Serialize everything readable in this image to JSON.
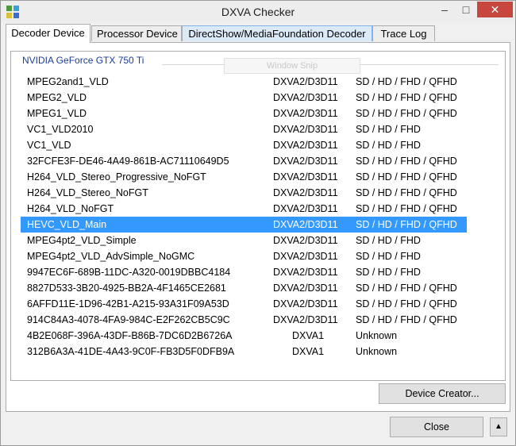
{
  "window": {
    "title": "DXVA Checker",
    "controls": {
      "minimize": "–",
      "maximize": "□",
      "close": "✕"
    },
    "icon": "dxva-app-icon"
  },
  "tabs": [
    {
      "label": "Decoder Device",
      "active": true
    },
    {
      "label": "Processor Device",
      "active": false
    },
    {
      "label": "DirectShow/MediaFoundation Decoder",
      "active": false,
      "hover": true
    },
    {
      "label": "Trace Log",
      "active": false
    }
  ],
  "group": {
    "label": "NVIDIA GeForce GTX 750 Ti",
    "ghost_overlay": "Window Snip"
  },
  "decoders": [
    {
      "name": "MPEG2and1_VLD",
      "api": "DXVA2/D3D11",
      "resolutions": "SD / HD / FHD / QFHD"
    },
    {
      "name": "MPEG2_VLD",
      "api": "DXVA2/D3D11",
      "resolutions": "SD / HD / FHD / QFHD"
    },
    {
      "name": "MPEG1_VLD",
      "api": "DXVA2/D3D11",
      "resolutions": "SD / HD / FHD / QFHD"
    },
    {
      "name": "VC1_VLD2010",
      "api": "DXVA2/D3D11",
      "resolutions": "SD / HD / FHD"
    },
    {
      "name": "VC1_VLD",
      "api": "DXVA2/D3D11",
      "resolutions": "SD / HD / FHD"
    },
    {
      "name": "32FCFE3F-DE46-4A49-861B-AC71110649D5",
      "api": "DXVA2/D3D11",
      "resolutions": "SD / HD / FHD / QFHD"
    },
    {
      "name": "H264_VLD_Stereo_Progressive_NoFGT",
      "api": "DXVA2/D3D11",
      "resolutions": "SD / HD / FHD / QFHD"
    },
    {
      "name": "H264_VLD_Stereo_NoFGT",
      "api": "DXVA2/D3D11",
      "resolutions": "SD / HD / FHD / QFHD"
    },
    {
      "name": "H264_VLD_NoFGT",
      "api": "DXVA2/D3D11",
      "resolutions": "SD / HD / FHD / QFHD"
    },
    {
      "name": "HEVC_VLD_Main",
      "api": "DXVA2/D3D11",
      "resolutions": "SD / HD / FHD / QFHD",
      "selected": true
    },
    {
      "name": "MPEG4pt2_VLD_Simple",
      "api": "DXVA2/D3D11",
      "resolutions": "SD / HD / FHD"
    },
    {
      "name": "MPEG4pt2_VLD_AdvSimple_NoGMC",
      "api": "DXVA2/D3D11",
      "resolutions": "SD / HD / FHD"
    },
    {
      "name": "9947EC6F-689B-11DC-A320-0019DBBC4184",
      "api": "DXVA2/D3D11",
      "resolutions": "SD / HD / FHD"
    },
    {
      "name": "8827D533-3B20-4925-BB2A-4F1465CE2681",
      "api": "DXVA2/D3D11",
      "resolutions": "SD / HD / FHD / QFHD"
    },
    {
      "name": "6AFFD11E-1D96-42B1-A215-93A31F09A53D",
      "api": "DXVA2/D3D11",
      "resolutions": "SD / HD / FHD / QFHD"
    },
    {
      "name": "914C84A3-4078-4FA9-984C-E2F262CB5C9C",
      "api": "DXVA2/D3D11",
      "resolutions": "SD / HD / FHD / QFHD"
    },
    {
      "name": "4B2E068F-396A-43DF-B86B-7DC6D2B6726A",
      "api": "DXVA1",
      "resolutions": "Unknown"
    },
    {
      "name": "312B6A3A-41DE-4A43-9C0F-FB3D5F0DFB9A",
      "api": "DXVA1",
      "resolutions": "Unknown"
    }
  ],
  "buttons": {
    "device_creator": "Device Creator...",
    "close": "Close",
    "expand": "▲"
  }
}
